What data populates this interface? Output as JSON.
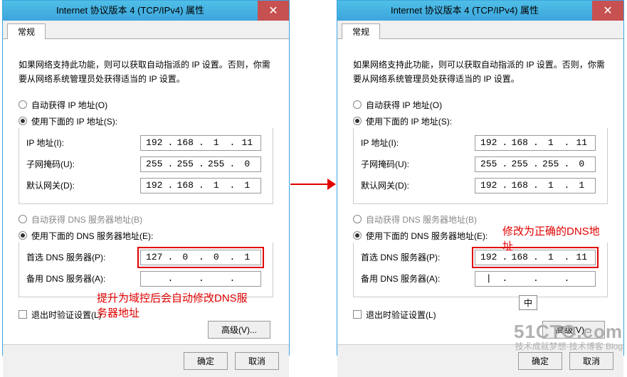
{
  "title": "Internet 协议版本 4 (TCP/IPv4) 属性",
  "tab_general": "常规",
  "desc": "如果网络支持此功能，则可以获取自动指派的 IP 设置。否则，你需要从网络系统管理员处获得适当的 IP 设置。",
  "radio_ip_auto": "自动获得 IP 地址(O)",
  "radio_ip_manual": "使用下面的 IP 地址(S):",
  "label_ip": "IP 地址(I):",
  "label_mask": "子网掩码(U):",
  "label_gateway": "默认网关(D):",
  "radio_dns_auto": "自动获得 DNS 服务器地址(B)",
  "radio_dns_manual": "使用下面的 DNS 服务器地址(E):",
  "label_dns1": "首选 DNS 服务器(P):",
  "label_dns2": "备用 DNS 服务器(A):",
  "chk_validate": "退出时验证设置(L)",
  "btn_advanced": "高级(V)...",
  "btn_ok": "确定",
  "btn_cancel": "取消",
  "ip": {
    "a": "192",
    "b": "168",
    "c": "1",
    "d": "11"
  },
  "mask": {
    "a": "255",
    "b": "255",
    "c": "255",
    "d": "0"
  },
  "gw": {
    "a": "192",
    "b": "168",
    "c": "1",
    "d": "1"
  },
  "left_dns1": {
    "a": "127",
    "b": "0",
    "c": "0",
    "d": "1"
  },
  "right_dns1": {
    "a": "192",
    "b": "168",
    "c": "1",
    "d": "11"
  },
  "note_left": "提升为域控后会自动修改DNS服务器地址",
  "note_right": "修改为正确的DNS地址",
  "ime": "中",
  "watermark_big": "51CTO.com",
  "watermark_small": "技术成就梦想·技术博客 Blog"
}
